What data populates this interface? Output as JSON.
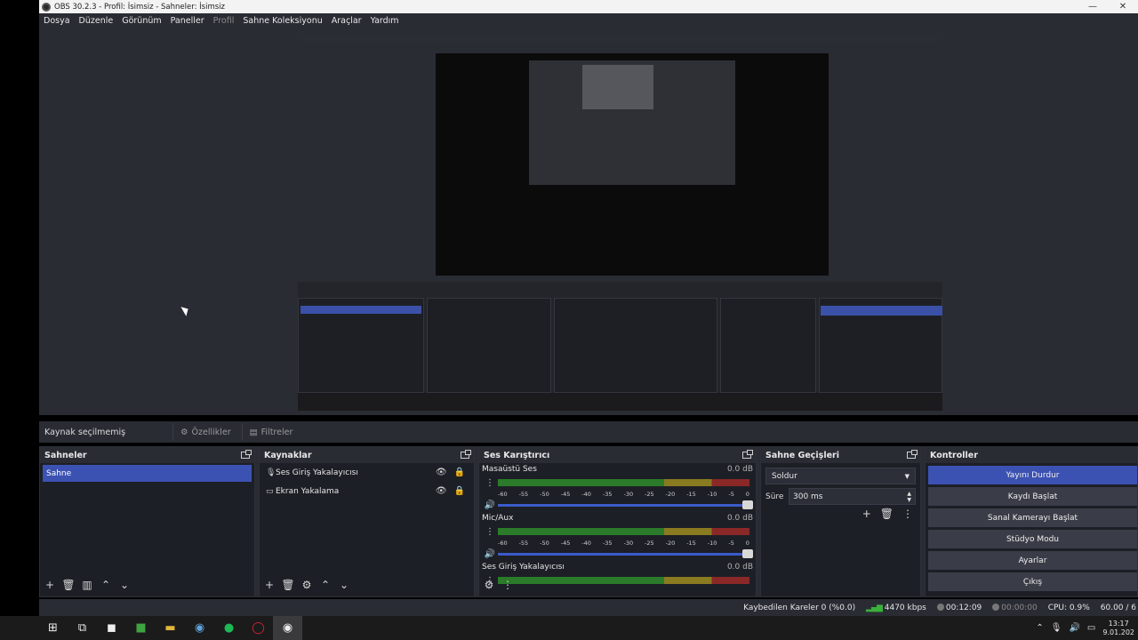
{
  "window": {
    "title": "OBS 30.2.3 - Profil: İsimsiz - Sahneler: İsimsiz",
    "minimize": "—",
    "close": "✕"
  },
  "menu": [
    "Dosya",
    "Düzenle",
    "Görünüm",
    "Paneller",
    "Profil",
    "Sahne Koleksiyonu",
    "Araçlar",
    "Yardım"
  ],
  "source_toolbar": {
    "no_source": "Kaynak seçilmemiş",
    "properties": "Özellikler",
    "filters": "Filtreler"
  },
  "scenes": {
    "title": "Sahneler",
    "items": [
      "Sahne"
    ]
  },
  "sources": {
    "title": "Kaynaklar",
    "items": [
      {
        "label": "Ses Giriş Yakalayıcısı",
        "icon": "microphone-icon"
      },
      {
        "label": "Ekran Yakalama",
        "icon": "monitor-icon"
      }
    ]
  },
  "mixer": {
    "title": "Ses Karıştırıcı",
    "scale": [
      "-60",
      "-55",
      "-50",
      "-45",
      "-40",
      "-35",
      "-30",
      "-25",
      "-20",
      "-15",
      "-10",
      "-5",
      "0"
    ],
    "channels": [
      {
        "name": "Masaüstü Ses",
        "db": "0.0 dB"
      },
      {
        "name": "Mic/Aux",
        "db": "0.0 dB"
      },
      {
        "name": "Ses Giriş Yakalayıcısı",
        "db": "0.0 dB"
      }
    ]
  },
  "transitions": {
    "title": "Sahne Geçişleri",
    "selected": "Soldur",
    "duration_label": "Süre",
    "duration_value": "300 ms"
  },
  "controls": {
    "title": "Kontroller",
    "buttons": [
      "Yayını Durdur",
      "Kaydı Başlat",
      "Sanal Kamerayı Başlat",
      "Stüdyo Modu",
      "Ayarlar",
      "Çıkış"
    ]
  },
  "status": {
    "dropped_frames": "Kaybedilen Kareler 0 (%0.0)",
    "bitrate": "4470 kbps",
    "stream_time": "00:12:09",
    "record_time": "00:00:00",
    "cpu": "CPU: 0.9%",
    "fps": "60.00 / 6"
  },
  "clock": {
    "time": "13:17",
    "date": "9.01.202"
  },
  "colors": {
    "accent": "#3c52b2",
    "panel": "#1d1f26",
    "chrome": "#2a2c34"
  }
}
